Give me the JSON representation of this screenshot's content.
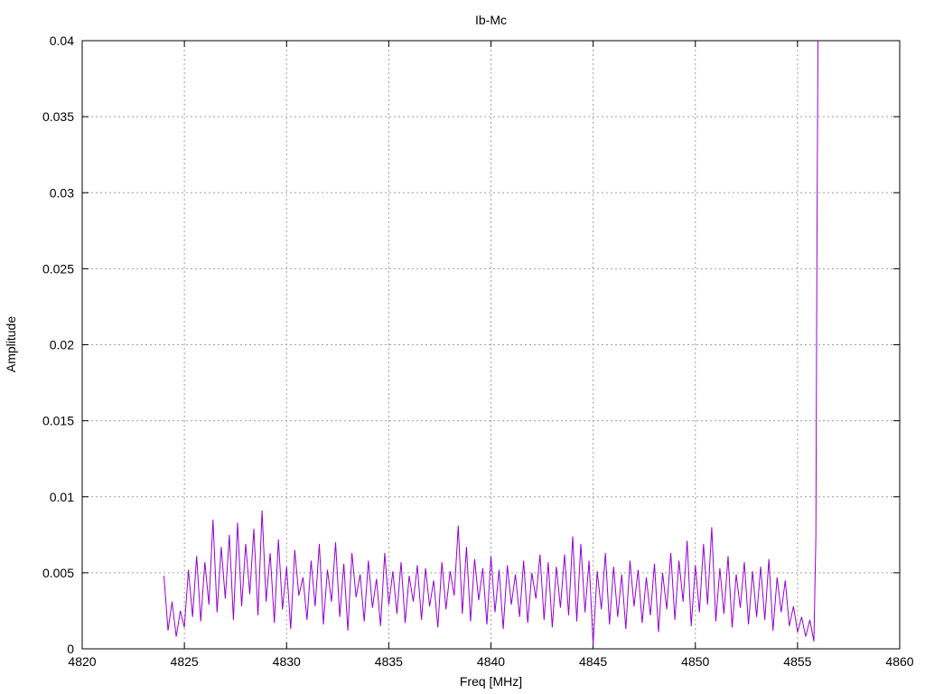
{
  "chart_data": {
    "type": "line",
    "title": "Ib-Mc",
    "xlabel": "Freq [MHz]",
    "ylabel": "Amplitude",
    "xlim": [
      4820,
      4860
    ],
    "ylim": [
      0,
      0.04
    ],
    "x_ticks": [
      "4820",
      "4825",
      "4830",
      "4835",
      "4840",
      "4845",
      "4850",
      "4855",
      "4860"
    ],
    "y_ticks": [
      "0",
      "0.005",
      "0.01",
      "0.015",
      "0.02",
      "0.025",
      "0.03",
      "0.035",
      "0.04"
    ],
    "grid": true,
    "series_color": "#9400d3",
    "series": [
      {
        "x": [
          4824.0,
          4824.2,
          4824.4,
          4824.6,
          4824.8,
          4825.0,
          4825.2,
          4825.4,
          4825.6,
          4825.8,
          4826.0,
          4826.2,
          4826.4,
          4826.6,
          4826.8,
          4827.0,
          4827.2,
          4827.4,
          4827.6,
          4827.8,
          4828.0,
          4828.2,
          4828.4,
          4828.6,
          4828.8,
          4829.0,
          4829.2,
          4829.4,
          4829.6,
          4829.8,
          4830.0,
          4830.2,
          4830.4,
          4830.6,
          4830.8,
          4831.0,
          4831.2,
          4831.4,
          4831.6,
          4831.8,
          4832.0,
          4832.2,
          4832.4,
          4832.6,
          4832.8,
          4833.0,
          4833.2,
          4833.4,
          4833.6,
          4833.8,
          4834.0,
          4834.2,
          4834.4,
          4834.6,
          4834.8,
          4835.0,
          4835.2,
          4835.4,
          4835.6,
          4835.8,
          4836.0,
          4836.2,
          4836.4,
          4836.6,
          4836.8,
          4837.0,
          4837.2,
          4837.4,
          4837.6,
          4837.8,
          4838.0,
          4838.2,
          4838.4,
          4838.6,
          4838.8,
          4839.0,
          4839.2,
          4839.4,
          4839.6,
          4839.8,
          4840.0,
          4840.2,
          4840.4,
          4840.6,
          4840.8,
          4841.0,
          4841.2,
          4841.4,
          4841.6,
          4841.8,
          4842.0,
          4842.2,
          4842.4,
          4842.6,
          4842.8,
          4843.0,
          4843.2,
          4843.4,
          4843.6,
          4843.8,
          4844.0,
          4844.2,
          4844.4,
          4844.6,
          4844.8,
          4845.0,
          4845.2,
          4845.4,
          4845.6,
          4845.8,
          4846.0,
          4846.2,
          4846.4,
          4846.6,
          4846.8,
          4847.0,
          4847.2,
          4847.4,
          4847.6,
          4847.8,
          4848.0,
          4848.2,
          4848.4,
          4848.6,
          4848.8,
          4849.0,
          4849.2,
          4849.4,
          4849.6,
          4849.8,
          4850.0,
          4850.2,
          4850.4,
          4850.6,
          4850.8,
          4851.0,
          4851.2,
          4851.4,
          4851.6,
          4851.8,
          4852.0,
          4852.2,
          4852.4,
          4852.6,
          4852.8,
          4853.0,
          4853.2,
          4853.4,
          4853.6,
          4853.8,
          4854.0,
          4854.2,
          4854.4,
          4854.6,
          4854.8,
          4855.0,
          4855.2,
          4855.4,
          4855.6,
          4855.8,
          4855.9,
          4855.95,
          4856.0
        ],
        "y": [
          0.0048,
          0.0012,
          0.0031,
          0.0008,
          0.0025,
          0.0014,
          0.0052,
          0.0021,
          0.0061,
          0.0018,
          0.0057,
          0.0029,
          0.0085,
          0.0024,
          0.0067,
          0.0033,
          0.0075,
          0.0019,
          0.0083,
          0.0028,
          0.0069,
          0.0036,
          0.0079,
          0.0022,
          0.0091,
          0.0031,
          0.0063,
          0.0017,
          0.0072,
          0.0026,
          0.0054,
          0.0013,
          0.0065,
          0.0035,
          0.0047,
          0.0019,
          0.0058,
          0.0028,
          0.0069,
          0.0016,
          0.0052,
          0.0031,
          0.007,
          0.0021,
          0.0056,
          0.0012,
          0.0063,
          0.0034,
          0.0049,
          0.0018,
          0.0058,
          0.0027,
          0.0046,
          0.0015,
          0.0063,
          0.0029,
          0.0051,
          0.0023,
          0.0057,
          0.0017,
          0.0048,
          0.0031,
          0.0055,
          0.0019,
          0.0053,
          0.0028,
          0.0045,
          0.0014,
          0.0057,
          0.0026,
          0.0051,
          0.0035,
          0.0081,
          0.0023,
          0.0067,
          0.0018,
          0.0059,
          0.0032,
          0.0053,
          0.0016,
          0.0061,
          0.0024,
          0.0052,
          0.0013,
          0.0055,
          0.0029,
          0.0049,
          0.0021,
          0.0058,
          0.0017,
          0.005,
          0.0033,
          0.0062,
          0.0019,
          0.0057,
          0.0014,
          0.0054,
          0.0027,
          0.0062,
          0.0022,
          0.0074,
          0.0018,
          0.0069,
          0.0024,
          0.0058,
          0.0003,
          0.0051,
          0.0026,
          0.0063,
          0.0016,
          0.0054,
          0.0021,
          0.0049,
          0.0013,
          0.0058,
          0.0028,
          0.0052,
          0.0017,
          0.0047,
          0.0022,
          0.0056,
          0.0011,
          0.005,
          0.0026,
          0.0063,
          0.0019,
          0.0058,
          0.0031,
          0.0071,
          0.0015,
          0.0055,
          0.0024,
          0.0069,
          0.0029,
          0.008,
          0.0018,
          0.0053,
          0.0023,
          0.0061,
          0.0014,
          0.0049,
          0.0027,
          0.0057,
          0.0016,
          0.0051,
          0.0021,
          0.0054,
          0.0019,
          0.0059,
          0.0012,
          0.0047,
          0.0024,
          0.0045,
          0.0015,
          0.0028,
          0.0011,
          0.0021,
          0.0008,
          0.0019,
          0.0005,
          0.0074,
          0.0268,
          0.04
        ]
      }
    ]
  }
}
